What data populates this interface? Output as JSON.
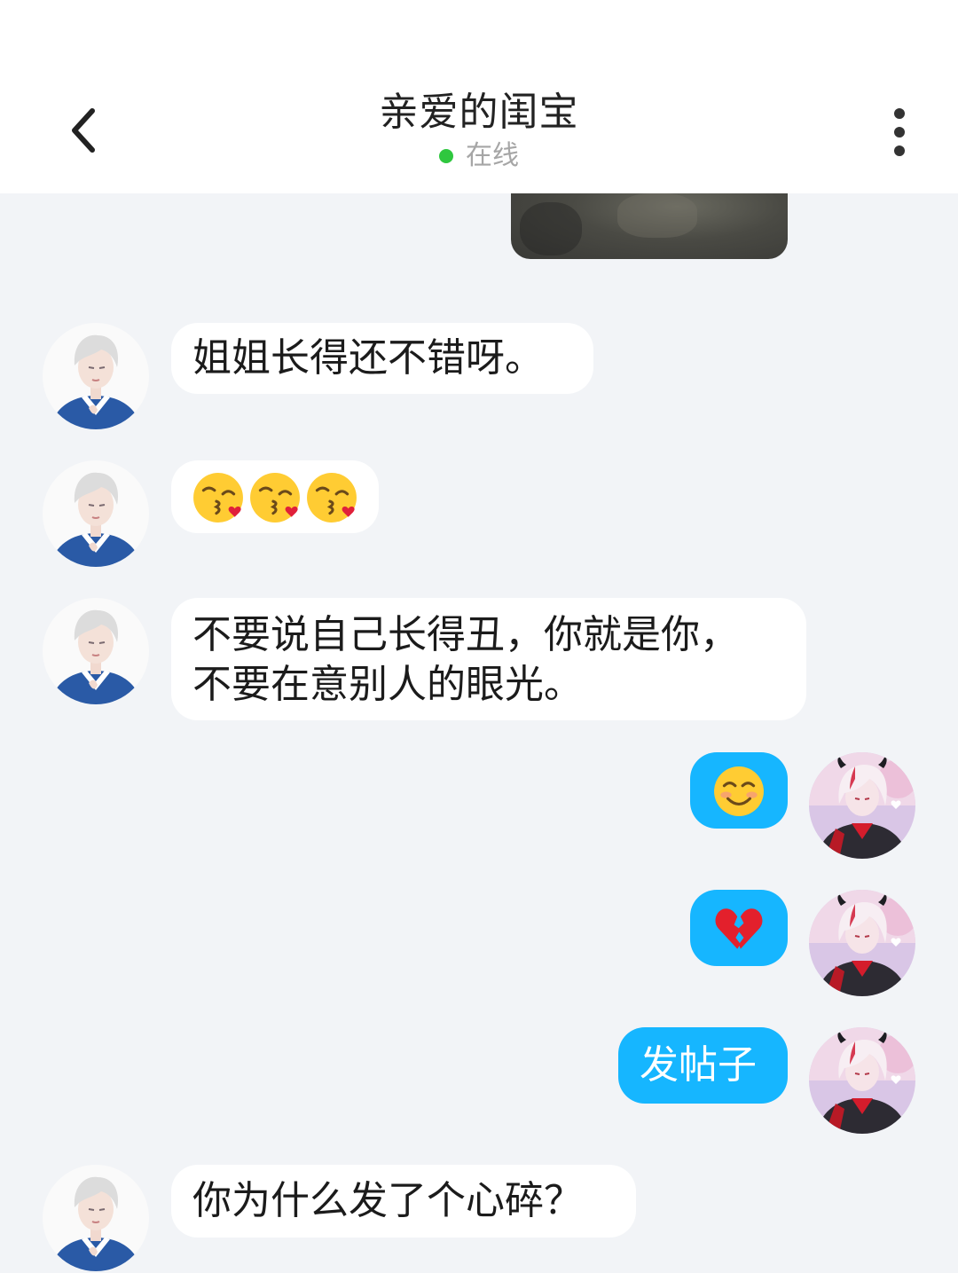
{
  "header": {
    "back_icon": "chevron-left-icon",
    "title": "亲爱的闺宝",
    "status": "在线",
    "status_color": "#2fc73f",
    "more_icon": "more-vertical-icon"
  },
  "messages": [
    {
      "side": "right",
      "type": "image",
      "content": "photo"
    },
    {
      "side": "left",
      "type": "text",
      "text": "姐姐长得还不错呀。"
    },
    {
      "side": "left",
      "type": "emoji",
      "emojis": [
        "face-blowing-kiss",
        "face-blowing-kiss",
        "face-blowing-kiss"
      ]
    },
    {
      "side": "left",
      "type": "text",
      "lines": [
        "不要说自己长得丑，你就是你，",
        "不要在意别人的眼光。"
      ]
    },
    {
      "side": "right",
      "type": "emoji",
      "emojis": [
        "smiling-face"
      ]
    },
    {
      "side": "right",
      "type": "emoji",
      "emojis": [
        "broken-heart"
      ]
    },
    {
      "side": "right",
      "type": "text",
      "text": "发帖子"
    },
    {
      "side": "left",
      "type": "text",
      "text": "你为什么发了个心碎？"
    }
  ],
  "colors": {
    "background": "#f2f4f7",
    "incoming_bubble": "#ffffff",
    "outgoing_bubble": "#16b6ff"
  }
}
